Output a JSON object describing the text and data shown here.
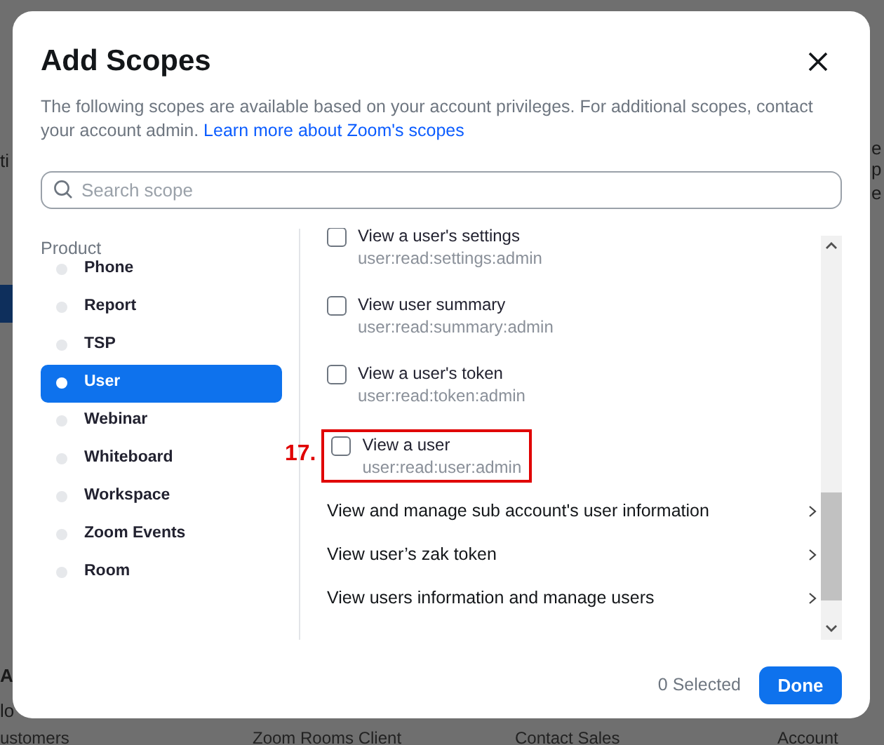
{
  "background_page": {
    "left_fragments": [
      "ti",
      "A",
      "lo"
    ],
    "right_fragments": [
      "e",
      "p",
      "e"
    ],
    "footer_links": [
      "ustomers",
      "Zoom Rooms Client",
      "Contact Sales",
      "Account"
    ]
  },
  "dialog": {
    "title": "Add Scopes",
    "description": "The following scopes are available based on your account privileges. For additional scopes, contact your account admin.",
    "learn_more_link": "Learn more about Zoom's scopes",
    "search": {
      "placeholder": "Search scope"
    },
    "category_heading": "Product",
    "categories": [
      {
        "label": "Phone",
        "selected": false
      },
      {
        "label": "Report",
        "selected": false
      },
      {
        "label": "TSP",
        "selected": false
      },
      {
        "label": "User",
        "selected": true
      },
      {
        "label": "Webinar",
        "selected": false
      },
      {
        "label": "Whiteboard",
        "selected": false
      },
      {
        "label": "Workspace",
        "selected": false
      },
      {
        "label": "Zoom Events",
        "selected": false
      },
      {
        "label": "Room",
        "selected": false
      }
    ],
    "scopes": [
      {
        "kind": "scope",
        "name": "View a user's settings",
        "code": "user:read:settings:admin",
        "checked": false
      },
      {
        "kind": "scope",
        "name": "View user summary",
        "code": "user:read:summary:admin",
        "checked": false
      },
      {
        "kind": "scope",
        "name": "View a user's token",
        "code": "user:read:token:admin",
        "checked": false
      },
      {
        "kind": "scope",
        "name": "View a user",
        "code": "user:read:user:admin",
        "checked": false,
        "annotation": "17."
      },
      {
        "kind": "group",
        "name": "View and manage sub account's user information"
      },
      {
        "kind": "group",
        "name": "View user’s zak token"
      },
      {
        "kind": "group",
        "name": "View users information and manage users"
      }
    ],
    "selected_count": "0 Selected",
    "done_button": "Done"
  }
}
